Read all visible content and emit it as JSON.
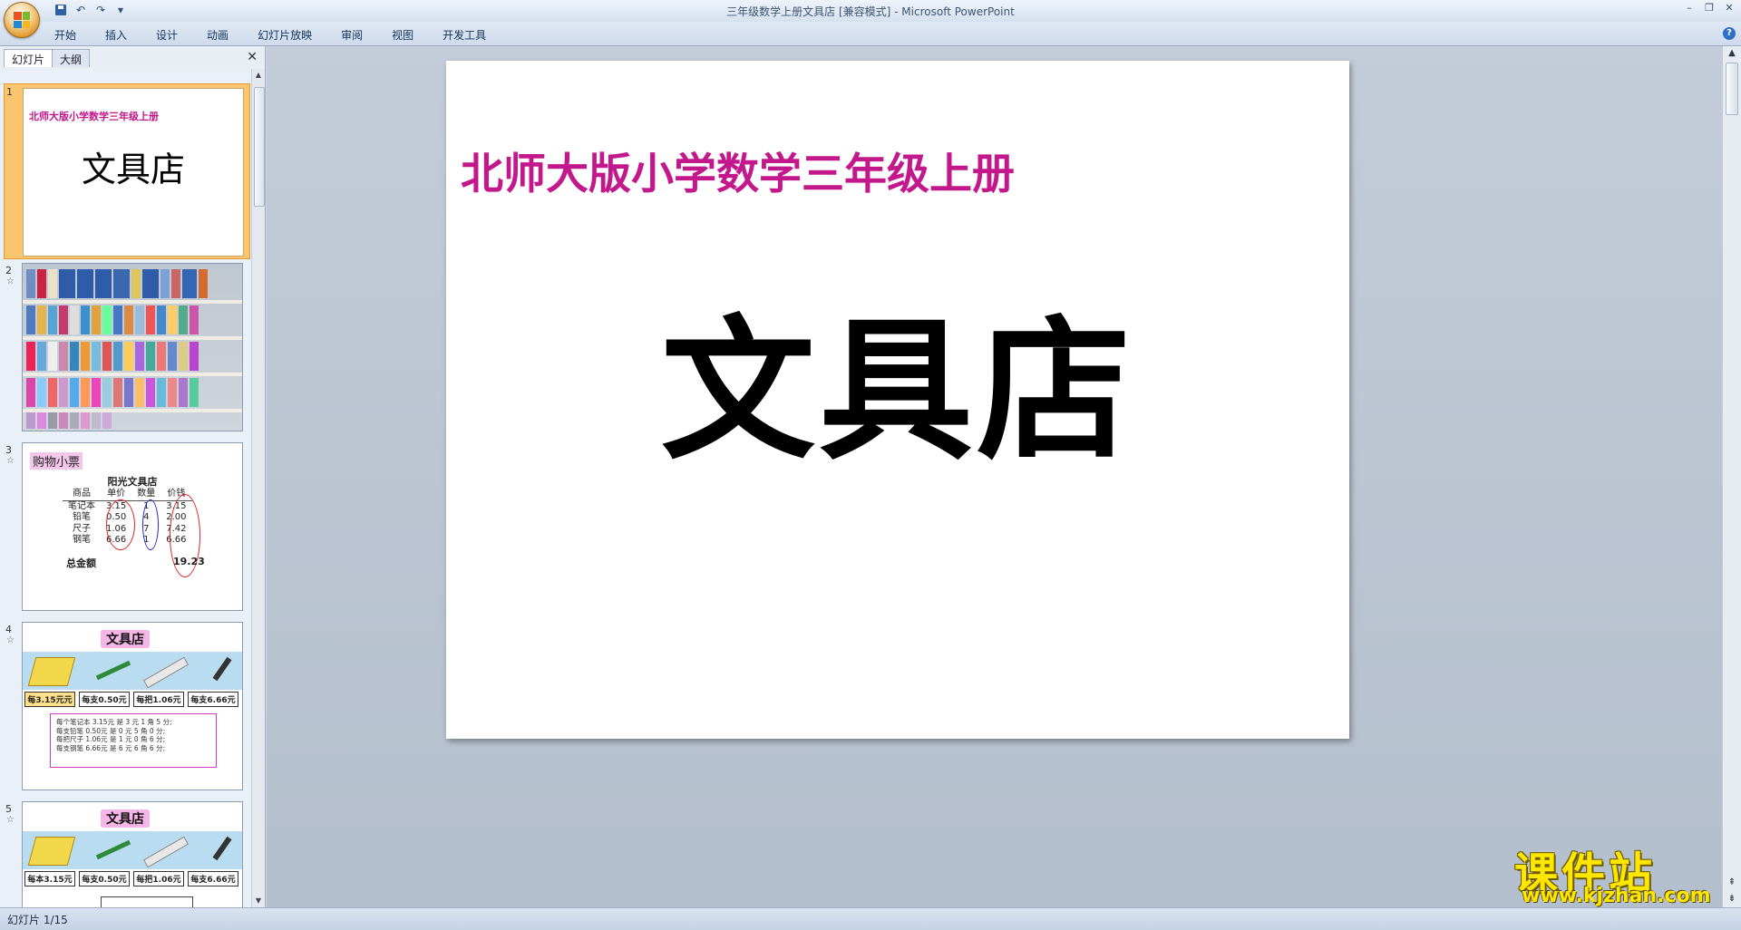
{
  "window": {
    "title": "三年级数学上册文具店 [兼容模式] - Microsoft PowerPoint"
  },
  "quick_access": {
    "undo_glyph": "↶",
    "redo_glyph": "↷",
    "customize_glyph": "▾"
  },
  "window_controls": {
    "minimize": "–",
    "restore": "❐",
    "close": "✕"
  },
  "ribbon": {
    "tabs": [
      "开始",
      "插入",
      "设计",
      "动画",
      "幻灯片放映",
      "审阅",
      "视图",
      "开发工具"
    ],
    "help": "?"
  },
  "left_pane": {
    "tabs": [
      "幻灯片",
      "大纲"
    ],
    "close": "✕",
    "thumbnails": [
      {
        "num": "1",
        "subtitle": "北师大版小学数学三年级上册",
        "title": "文具店"
      },
      {
        "num": "2"
      },
      {
        "num": "3",
        "label": "购物小票",
        "store": "阳光文具店",
        "headers": [
          "商品",
          "单价",
          "数量",
          "价钱"
        ],
        "rows": [
          [
            "笔记本",
            "3.15",
            "1",
            "3.15"
          ],
          [
            "铅笔",
            "0.50",
            "4",
            "2.00"
          ],
          [
            "尺子",
            "1.06",
            "7",
            "7.42"
          ],
          [
            "钢笔",
            "6.66",
            "1",
            "6.66"
          ]
        ],
        "total_label": "总金额",
        "total_value": "19.23"
      },
      {
        "num": "4",
        "title": "文具店",
        "prices": [
          "每3.15元元",
          "每支0.50元",
          "每把1.06元",
          "每支6.66元"
        ],
        "lines": [
          "每个笔记本 3.15元 是 3 元 1 角 5 分;",
          "每支铅笔 0.50元 是 0 元 5 角 0 分;",
          "每把尺子 1.06元 是 1 元 0 角 6 分;",
          "每支钢笔 6.66元 是 6 元 6 角 6 分;"
        ]
      },
      {
        "num": "5",
        "title": "文具店",
        "prices": [
          "每本3.15元",
          "每支0.50元",
          "每把1.06元",
          "每支6.66元"
        ]
      }
    ],
    "star_glyph": "☆"
  },
  "slide": {
    "subtitle": "北师大版小学数学三年级上册",
    "title": "文具店"
  },
  "watermark": {
    "text": "课件站",
    "url": "www.kjzhan.com"
  },
  "status": {
    "slide_counter": "幻灯片 1/15"
  },
  "colors": {
    "accent_magenta": "#c3178c",
    "selection_orange": "#f9c56f",
    "watermark_yellow": "#ffe600"
  }
}
